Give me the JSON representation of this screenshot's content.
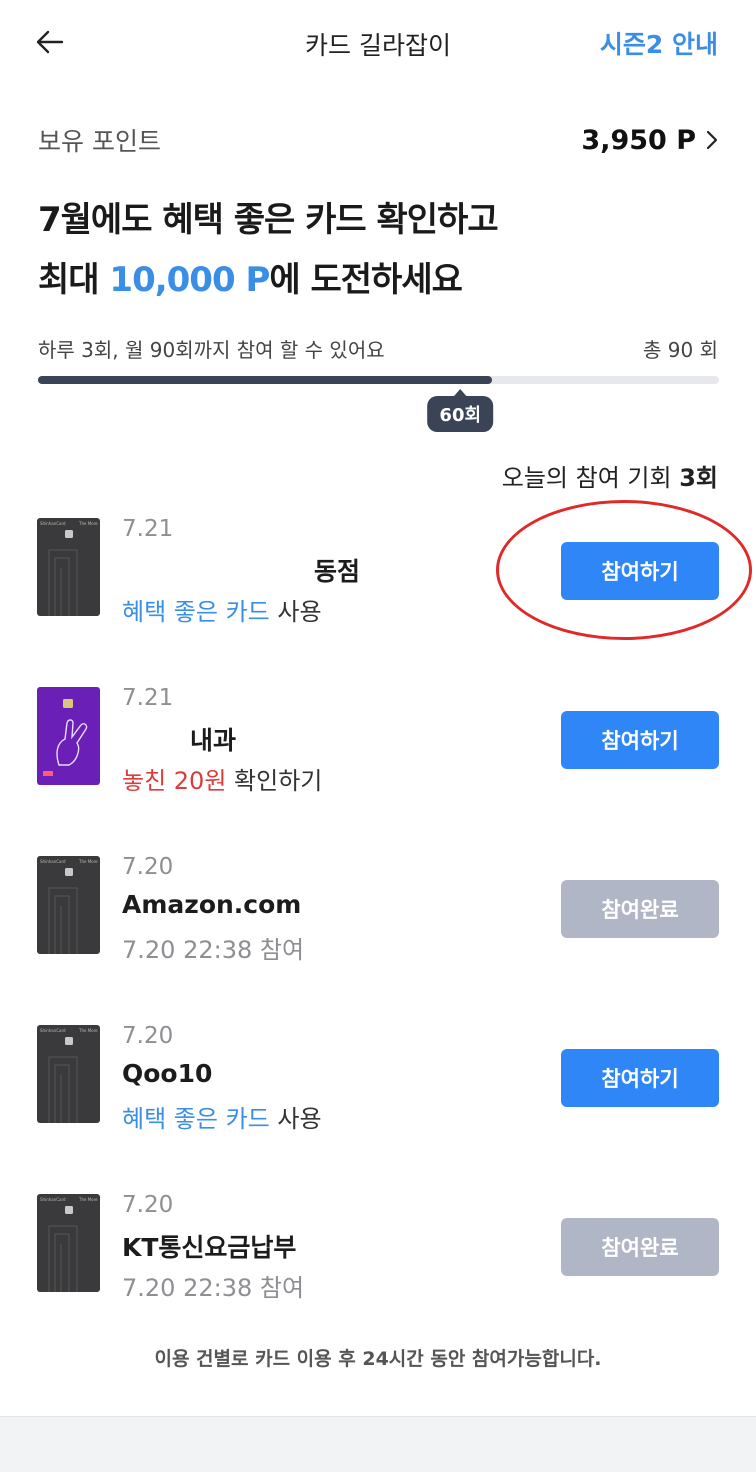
{
  "header": {
    "title": "카드 길라잡이",
    "season_link": "시즌2 안내",
    "back_icon": "arrow-left-icon"
  },
  "points": {
    "label": "보유 포인트",
    "value": "3,950 P"
  },
  "headline": {
    "line1": "7월에도 혜택 좋은 카드 확인하고",
    "line2_prefix": "최대 ",
    "line2_accent": "10,000 P",
    "line2_suffix": "에 도전하세요"
  },
  "progress": {
    "note": "하루 3회, 월 90회까지 참여 할 수 있어요",
    "total_label": "총 90 회",
    "current_badge": "60회",
    "fraction": 0.667
  },
  "today": {
    "label": "오늘의 참여 기회 ",
    "count": "3회"
  },
  "transactions": [
    {
      "date": "7.21",
      "merchant": "동점",
      "sub_accent": "혜택 좋은 카드",
      "sub_rest": " 사용",
      "sub_type": "blue",
      "button": "참여하기",
      "button_state": "active",
      "card": "dark"
    },
    {
      "date": "7.21",
      "merchant": "내과",
      "sub_accent": "놓친 20원",
      "sub_rest": " 확인하기",
      "sub_type": "red",
      "button": "참여하기",
      "button_state": "active",
      "card": "purple"
    },
    {
      "date": "7.20",
      "merchant": "Amazon.com",
      "sub_accent": "7.20 22:38 참여",
      "sub_rest": "",
      "sub_type": "gray",
      "button": "참여완료",
      "button_state": "done",
      "card": "dark"
    },
    {
      "date": "7.20",
      "merchant": "Qoo10",
      "sub_accent": "혜택 좋은 카드",
      "sub_rest": " 사용",
      "sub_type": "blue",
      "button": "참여하기",
      "button_state": "active",
      "card": "dark"
    },
    {
      "date": "7.20",
      "merchant": "KT통신요금납부",
      "sub_accent": "7.20 22:38 참여",
      "sub_rest": "",
      "sub_type": "gray",
      "button": "참여완료",
      "button_state": "done",
      "card": "dark"
    }
  ],
  "footnote": "이용 건별로 카드 이용 후 24시간 동안 참여가능합니다.",
  "colors": {
    "accent": "#3a8ee6",
    "button_active": "#2f86f6",
    "button_done": "#b0b6c6",
    "warning": "#e03b3b",
    "annotation": "#e02a2a"
  }
}
